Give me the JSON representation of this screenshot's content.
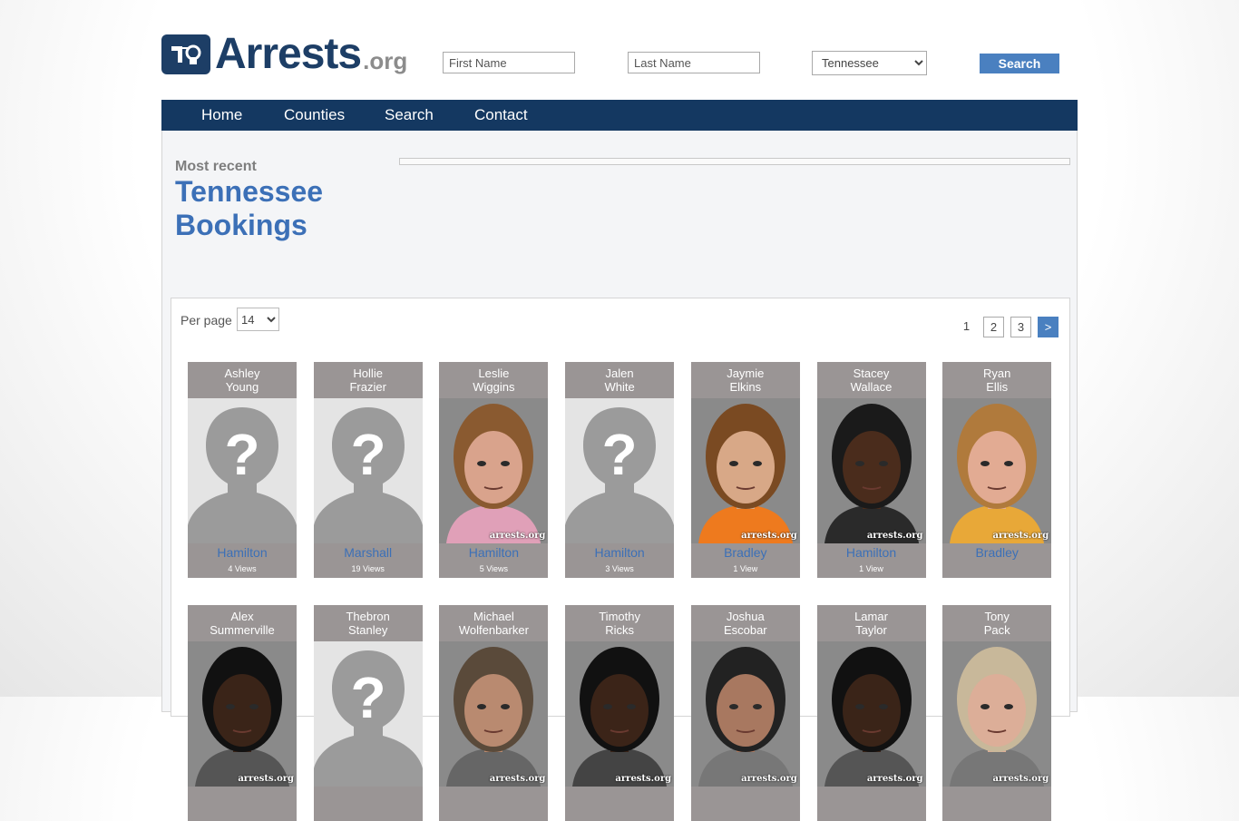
{
  "site": {
    "logo_main": "Arrests",
    "logo_ext": ".org"
  },
  "search": {
    "first_name_placeholder": "First Name",
    "last_name_placeholder": "Last Name",
    "state_selected": "Tennessee",
    "search_label": "Search"
  },
  "nav": {
    "items": [
      "Home",
      "Counties",
      "Search",
      "Contact"
    ]
  },
  "page": {
    "most_recent": "Most recent",
    "title": "Tennessee Bookings"
  },
  "listing": {
    "per_page_label": "Per page",
    "per_page_value": "14",
    "pages": [
      "1",
      "2",
      "3"
    ],
    "next_label": ">",
    "watermark": "arrests.org",
    "bookings": [
      {
        "first": "Ashley",
        "last": "Young",
        "county": "Hamilton",
        "views": "4 Views",
        "photo": "unknown",
        "skin": "",
        "hair": "",
        "shirt": ""
      },
      {
        "first": "Hollie",
        "last": "Frazier",
        "county": "Marshall",
        "views": "19 Views",
        "photo": "unknown",
        "skin": "",
        "hair": "",
        "shirt": ""
      },
      {
        "first": "Leslie",
        "last": "Wiggins",
        "county": "Hamilton",
        "views": "5 Views",
        "photo": "real",
        "skin": "#d9a38c",
        "hair": "#8a5a30",
        "shirt": "#e0a0b8"
      },
      {
        "first": "Jalen",
        "last": "White",
        "county": "Hamilton",
        "views": "3 Views",
        "photo": "unknown",
        "skin": "",
        "hair": "",
        "shirt": ""
      },
      {
        "first": "Jaymie",
        "last": "Elkins",
        "county": "Bradley",
        "views": "1 View",
        "photo": "real",
        "skin": "#d8a887",
        "hair": "#7a4a22",
        "shirt": "#ee7a1e"
      },
      {
        "first": "Stacey",
        "last": "Wallace",
        "county": "Hamilton",
        "views": "1 View",
        "photo": "real",
        "skin": "#4a2c1c",
        "hair": "#1a1a1a",
        "shirt": "#2a2a2a"
      },
      {
        "first": "Ryan",
        "last": "Ellis",
        "county": "Bradley",
        "views": "",
        "photo": "real",
        "skin": "#e2ab93",
        "hair": "#b07a3c",
        "shirt": "#e8a838"
      },
      {
        "first": "Alex",
        "last": "Summerville",
        "county": "",
        "views": "",
        "photo": "real",
        "skin": "#3a2418",
        "hair": "#111111",
        "shirt": "#555555"
      },
      {
        "first": "Thebron",
        "last": "Stanley",
        "county": "",
        "views": "",
        "photo": "unknown",
        "skin": "",
        "hair": "",
        "shirt": ""
      },
      {
        "first": "Michael",
        "last": "Wolfenbarker",
        "county": "",
        "views": "",
        "photo": "real",
        "skin": "#b98a70",
        "hair": "#5a4a3a",
        "shirt": "#666666"
      },
      {
        "first": "Timothy",
        "last": "Ricks",
        "county": "",
        "views": "",
        "photo": "real",
        "skin": "#3b2418",
        "hair": "#111111",
        "shirt": "#444444"
      },
      {
        "first": "Joshua",
        "last": "Escobar",
        "county": "",
        "views": "",
        "photo": "real",
        "skin": "#a87860",
        "hair": "#222222",
        "shirt": "#777777"
      },
      {
        "first": "Lamar",
        "last": "Taylor",
        "county": "",
        "views": "",
        "photo": "real",
        "skin": "#3a2418",
        "hair": "#111111",
        "shirt": "#555555"
      },
      {
        "first": "Tony",
        "last": "Pack",
        "county": "",
        "views": "",
        "photo": "real",
        "skin": "#dcae98",
        "hair": "#c8b89a",
        "shirt": "#777777"
      }
    ]
  },
  "colors": {
    "nav_bg": "#143861",
    "accent": "#3c70b7",
    "button": "#4a80c0",
    "card_bg": "#9a9595"
  }
}
